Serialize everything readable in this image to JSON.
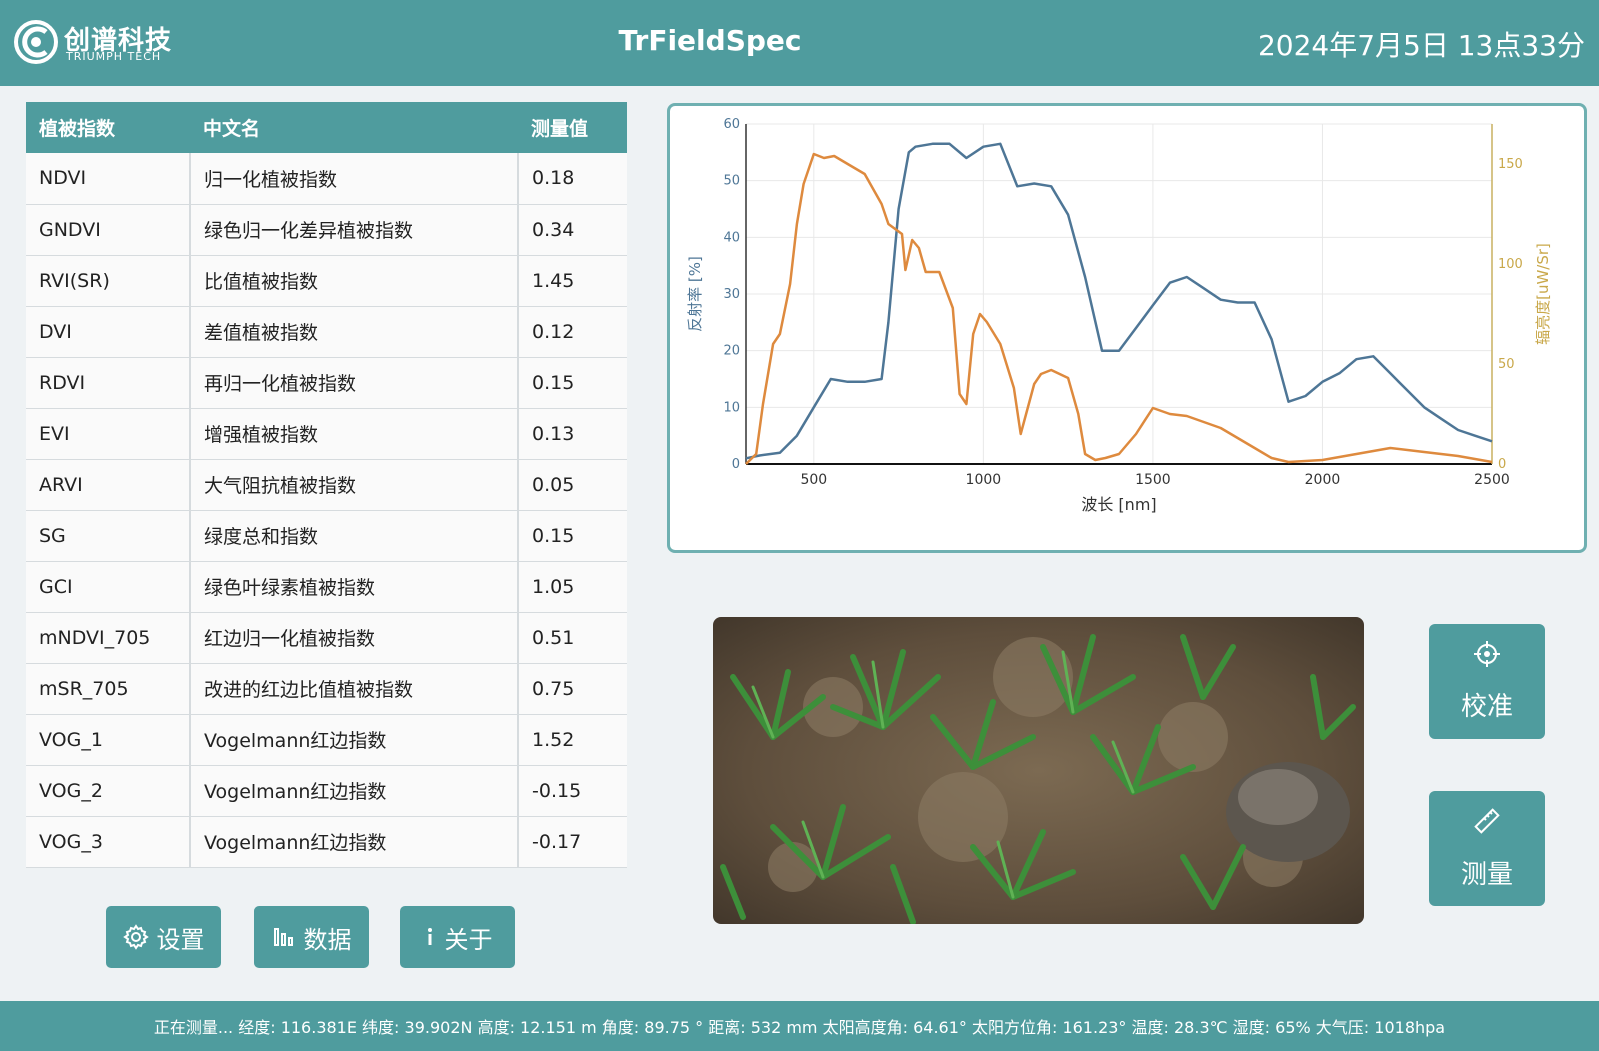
{
  "header": {
    "logo_cn": "创谱科技",
    "logo_en": "TRIUMPH TECH",
    "title": "TrFieldSpec",
    "datetime": "2024年7月5日 13点33分"
  },
  "table": {
    "headers": [
      "植被指数",
      "中文名",
      "测量值"
    ],
    "rows": [
      [
        "NDVI",
        "归一化植被指数",
        "0.18"
      ],
      [
        "GNDVI",
        "绿色归一化差异植被指数",
        "0.34"
      ],
      [
        "RVI(SR)",
        "比值植被指数",
        "1.45"
      ],
      [
        "DVI",
        "差值植被指数",
        "0.12"
      ],
      [
        "RDVI",
        "再归一化植被指数",
        "0.15"
      ],
      [
        "EVI",
        "增强植被指数",
        "0.13"
      ],
      [
        "ARVI",
        "大气阻抗植被指数",
        "0.05"
      ],
      [
        "SG",
        "绿度总和指数",
        "0.15"
      ],
      [
        "GCI",
        "绿色叶绿素植被指数",
        "1.05"
      ],
      [
        "mNDVI_705",
        "红边归一化植被指数",
        "0.51"
      ],
      [
        "mSR_705",
        "改进的红边比值植被指数",
        "0.75"
      ],
      [
        "VOG_1",
        "Vogelmann红边指数",
        "1.52"
      ],
      [
        "VOG_2",
        "Vogelmann红边指数",
        "-0.15"
      ],
      [
        "VOG_3",
        "Vogelmann红边指数",
        "-0.17"
      ]
    ]
  },
  "buttons": {
    "settings": "设置",
    "data": "数据",
    "about": "关于",
    "calibrate": "校准",
    "measure": "测量"
  },
  "statusbar": {
    "text": "正在测量... 经度: 116.381E 纬度: 39.902N 高度: 12.151 m 角度: 89.75 ° 距离: 532 mm 太阳高度角: 64.61° 太阳方位角: 161.23° 温度: 28.3℃ 湿度: 65% 大气压: 1018hpa"
  },
  "colors": {
    "accent": "#4f9c9e",
    "reflectance": "#4e7696",
    "radiance": "#de8a3e"
  },
  "chart_data": {
    "type": "line",
    "xlabel": "波长 [nm]",
    "ylabel": "反射率 [%]",
    "y2label": "辐亮度[uW/Sr]",
    "xlim": [
      300,
      2500
    ],
    "ylim": [
      0,
      60
    ],
    "y2lim": [
      0,
      170
    ],
    "xticks": [
      500,
      1000,
      1500,
      2000,
      2500
    ],
    "yticks": [
      0,
      10,
      20,
      30,
      40,
      50,
      60
    ],
    "y2ticks": [
      0,
      50,
      100,
      150
    ],
    "grid": true,
    "series": [
      {
        "axis": "left",
        "x": [
          300,
          340,
          400,
          450,
          500,
          550,
          600,
          650,
          700,
          720,
          750,
          780,
          800,
          850,
          900,
          950,
          1000,
          1050,
          1100,
          1150,
          1200,
          1250,
          1300,
          1350,
          1400,
          1450,
          1500,
          1550,
          1600,
          1650,
          1700,
          1750,
          1800,
          1850,
          1900,
          1950,
          2000,
          2050,
          2100,
          2150,
          2200,
          2250,
          2300,
          2350,
          2400,
          2450,
          2500
        ],
        "y": [
          1,
          1.5,
          2,
          5,
          10,
          15,
          14.5,
          14.5,
          15,
          25,
          45,
          55,
          56,
          56.5,
          56.5,
          54,
          56,
          56.5,
          49,
          49.5,
          49,
          44,
          33,
          20,
          20,
          24,
          28,
          32,
          33,
          31,
          29,
          28.5,
          28.5,
          22,
          11,
          12,
          14.5,
          16,
          18.5,
          19,
          16,
          13,
          10,
          8,
          6,
          5,
          4
        ]
      },
      {
        "axis": "right",
        "x": [
          300,
          330,
          350,
          380,
          400,
          430,
          450,
          470,
          500,
          530,
          560,
          600,
          650,
          700,
          720,
          760,
          770,
          790,
          810,
          830,
          870,
          910,
          930,
          950,
          970,
          990,
          1010,
          1050,
          1090,
          1110,
          1150,
          1170,
          1200,
          1250,
          1280,
          1300,
          1330,
          1360,
          1400,
          1450,
          1500,
          1550,
          1600,
          1700,
          1800,
          1850,
          1900,
          2000,
          2100,
          2200,
          2300,
          2400,
          2500
        ],
        "y": [
          0,
          5,
          30,
          60,
          65,
          90,
          120,
          140,
          155,
          153,
          154,
          150,
          145,
          130,
          120,
          115,
          97,
          112,
          108,
          96,
          96,
          78,
          35,
          30,
          65,
          75,
          71,
          60,
          38,
          15,
          40,
          45,
          47,
          43,
          25,
          5,
          2,
          3,
          5,
          15,
          28,
          25,
          24,
          18,
          8,
          3,
          1,
          2,
          5,
          8,
          6,
          4,
          1
        ]
      }
    ]
  }
}
